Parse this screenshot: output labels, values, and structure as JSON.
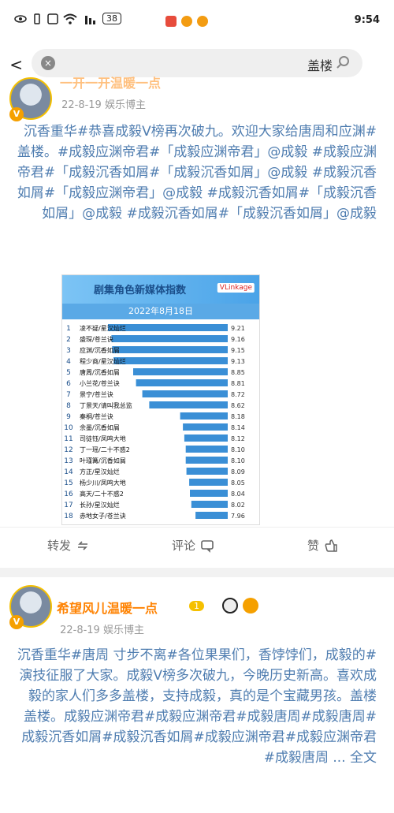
{
  "status": {
    "time": "9:54",
    "battery": "38"
  },
  "search": {
    "query": "盖楼",
    "clear_label": "×",
    "back_label": "<"
  },
  "post1": {
    "username": "一开一开温暖一点",
    "date": "22-8-19",
    "source": "娱乐博主",
    "content": "#沉香重华#恭喜成毅V榜再次破九。欢迎大家给唐周和应渊盖楼。#成毅应渊帝君#「成毅应渊帝君」@成毅 #成毅应渊帝君#「成毅沉香如屑#「成毅沉香如屑」@成毅 #成毅沉香如屑#「成毅应渊帝君」@成毅 #成毅沉香如屑#「成毅沉香如屑」@成毅 #成毅沉香如屑#「成毅沉香如屑」@成毅",
    "actions": {
      "repost": "转发",
      "comment": "评论",
      "like": "赞"
    }
  },
  "post2": {
    "username": "希望风儿温暖一点",
    "level": "1",
    "date": "22-8-19",
    "source": "娱乐博主",
    "content": "#沉香重华#唐周 寸步不离#各位果果们，香饽饽们，成毅的演技征服了大家。成毅V榜多次破九，今晚历史新高。喜欢成毅的家人们多多盖楼，支持成毅，真的是个宝藏男孩。盖楼盖楼。成毅应渊帝君#成毅应渊帝君#成毅唐周#成毅唐周#成毅沉香如屑#成毅沉香如屑#成毅应渊帝君#成毅应渊帝君#成毅唐周 ... 全文"
  },
  "chart_data": {
    "type": "bar",
    "title": "剧集角色新媒体指数",
    "brand": "VLinkage",
    "date": "2022年8月18日",
    "categories": [
      "凌不疑",
      "盛琛",
      "应渊",
      "程少商",
      "唐周",
      "小兰花",
      "景宁",
      "丁景天",
      "秦桐",
      "余墨",
      "司徒钰",
      "丁一瑶",
      "叶瑾篝",
      "方正",
      "杨少川",
      "高天",
      "长孙",
      "赤地女子"
    ],
    "labels": [
      "凌不疑/星汉灿烂",
      "盛琛/苍兰诀",
      "应渊/沉香如屑",
      "程少商/星汉灿烂",
      "唐周/沉香如屑",
      "小兰花/苍兰诀",
      "景宁/苍兰诀",
      "丁景天/请叫我总监",
      "秦桐/苍兰诀",
      "余墨/沉香如屑",
      "司徒钰/凤鸣大地",
      "丁一瑶/二十不惑2",
      "叶瑾篝/沉香如屑",
      "方正/星汉灿烂",
      "杨少川/凤鸣大地",
      "高天/二十不惑2",
      "长孙/星汉灿烂",
      "赤地女子/苍兰诀"
    ],
    "values": [
      9.21,
      9.16,
      9.15,
      9.13,
      8.85,
      8.81,
      8.72,
      8.62,
      8.18,
      8.14,
      8.12,
      8.1,
      8.1,
      8.09,
      8.05,
      8.04,
      8.02,
      7.96
    ],
    "xlim": [
      7.5,
      9.3
    ]
  }
}
